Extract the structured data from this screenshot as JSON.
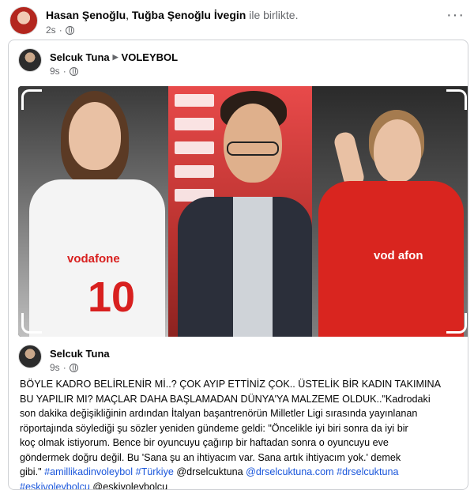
{
  "outer_post": {
    "author": "Hasan Şenoğlu",
    "separator": ", ",
    "tagged": "Tuğba Şenoğlu İvegin",
    "with_text": " ile birlikte.",
    "time": "2s",
    "more_label": "···"
  },
  "shared_post": {
    "author": "Selcuk Tuna",
    "group": "VOLEYBOL",
    "time": "9s"
  },
  "photo": {
    "left_jersey_number": "10",
    "left_sponsor": "vodafone",
    "right_sponsor": "vod afon"
  },
  "inner_post": {
    "author": "Selcuk Tuna",
    "time": "9s",
    "text_line1": "BÖYLE KADRO BELİRLENİR Mİ..? ÇOK AYIP ETTİNİZ ÇOK.. ÜSTELİK BİR KADIN TAKIMINA",
    "text_line2": "BU YAPILIR MI?  MAÇLAR DAHA BAŞLAMADAN DÜNYA'YA MALZEME OLDUK..\"Kadrodaki",
    "text_line3": "son dakika değişikliğinin ardından İtalyan başantrenörün Milletler Ligi sırasında yayınlanan",
    "text_line4": "röportajında söylediği şu sözler yeniden gündeme geldi: \"Öncelikle iyi biri sonra da iyi bir",
    "text_line5": "koç olmak istiyorum. Bence bir oyuncuyu çağırıp bir haftadan sonra o oyuncuyu eve",
    "text_line6": "göndermek doğru değil. Bu 'Sana şu an ihtiyacım var. Sana artık ihtiyacım yok.' demek",
    "text_line7_a": "gibi.\" ",
    "hashtag1": "#amillikadinvoleybol",
    "text_line7_b": " ",
    "hashtag2": "#Türkiye",
    "text_line7_c": " @drselcuktuna ",
    "mention1": "@drselcuktuna.com",
    "text_line7_d": " ",
    "hashtag3": "#drselcuktuna",
    "hashtag4": "#eskivoleybolcu",
    "text_line8_b": " @eskivoleybolcu"
  }
}
